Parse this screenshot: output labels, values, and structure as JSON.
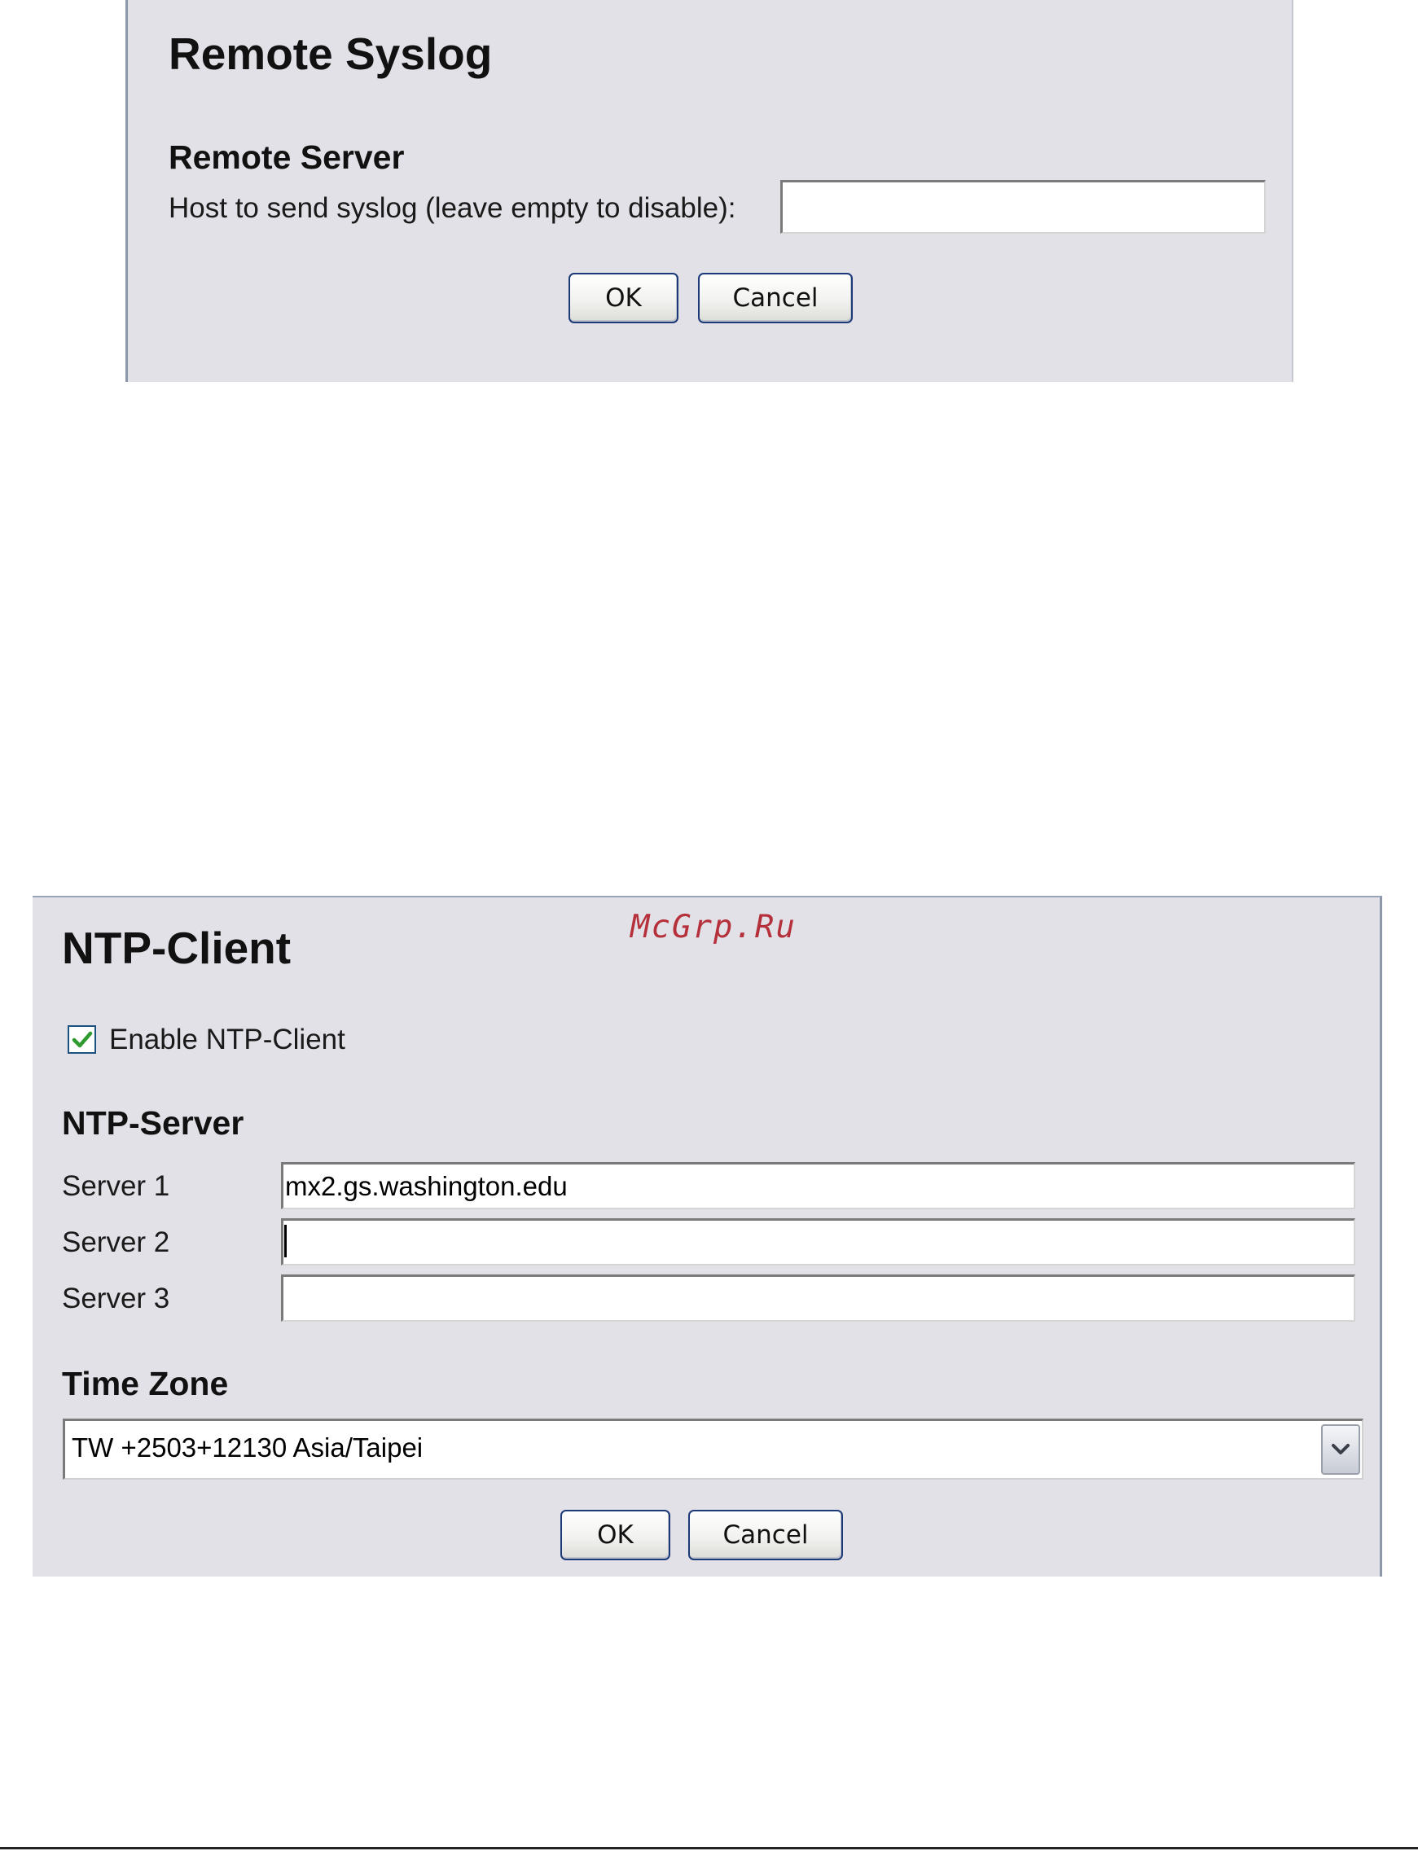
{
  "syslog": {
    "title": "Remote Syslog",
    "section": "Remote Server",
    "host_label": "Host to send syslog (leave empty to disable):",
    "host_value": "",
    "ok_label": "OK",
    "cancel_label": "Cancel"
  },
  "watermark": "McGrp.Ru",
  "ntp": {
    "title": "NTP-Client",
    "enable_label": "Enable NTP-Client",
    "enable_checked": true,
    "server_section": "NTP-Server",
    "servers": [
      {
        "label": "Server 1",
        "value": "mx2.gs.washington.edu"
      },
      {
        "label": "Server 2",
        "value": ""
      },
      {
        "label": "Server 3",
        "value": ""
      }
    ],
    "tz_section": "Time Zone",
    "tz_selected": "TW +2503+12130 Asia/Taipei",
    "ok_label": "OK",
    "cancel_label": "Cancel"
  },
  "icons": {
    "checkbox_check": "checkmark-icon",
    "select_arrow": "chevron-down-icon"
  },
  "colors": {
    "panel_bg": "#e1e1e7",
    "button_border": "#1d3a78",
    "check_green": "#2f9a2f",
    "watermark": "#b5303a"
  }
}
